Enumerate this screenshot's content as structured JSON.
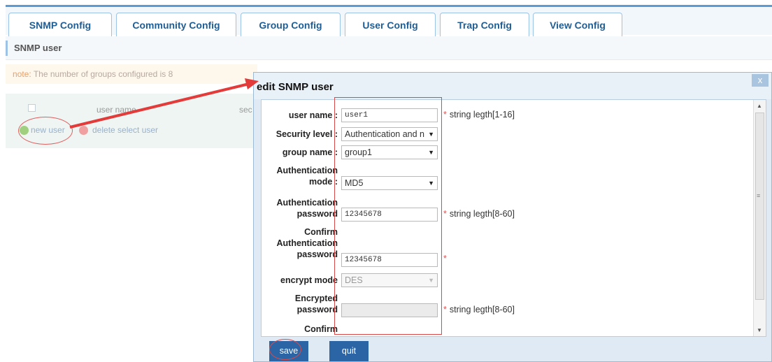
{
  "tabs": [
    {
      "label": "SNMP Config"
    },
    {
      "label": "Community Config"
    },
    {
      "label": "Group Config"
    },
    {
      "label": "User Config"
    },
    {
      "label": "Trap Config"
    },
    {
      "label": "View Config"
    }
  ],
  "subheader": {
    "title": "SNMP user"
  },
  "note": {
    "label": "note:",
    "text": "The number of groups configured is 8"
  },
  "list": {
    "col_user_name": "user name",
    "col_sec": "sec",
    "new_user": "new user",
    "delete_user": "delete select user"
  },
  "dialog": {
    "title": "edit SNMP user",
    "close": "x",
    "fields": {
      "user_name": {
        "label": "user name",
        "value": "user1",
        "hint": "string legth[1-16]"
      },
      "security_level": {
        "label": "Security level",
        "value": "Authentication and n"
      },
      "group_name": {
        "label": "group name",
        "value": "group1"
      },
      "auth_mode": {
        "label_1": "Authentication",
        "label_2": "mode",
        "value": "MD5"
      },
      "auth_password": {
        "label_1": "Authentication",
        "label_2": "password",
        "value": "12345678",
        "hint": "string legth[8-60]"
      },
      "confirm_auth_password": {
        "label_1": "Confirm",
        "label_2": "Authentication",
        "label_3": "password",
        "value": "12345678"
      },
      "encrypt_mode": {
        "label": "encrypt mode",
        "value": "DES"
      },
      "encrypted_password": {
        "label_1": "Encrypted",
        "label_2": "password",
        "value": "",
        "hint": "string legth[8-60]"
      },
      "confirm_encrypted": {
        "label": "Confirm"
      }
    },
    "buttons": {
      "save": "save",
      "quit": "quit"
    }
  },
  "colors": {
    "accent": "#2b65a6",
    "tab_text": "#1f5d95",
    "annotation": "#d84a4a"
  }
}
